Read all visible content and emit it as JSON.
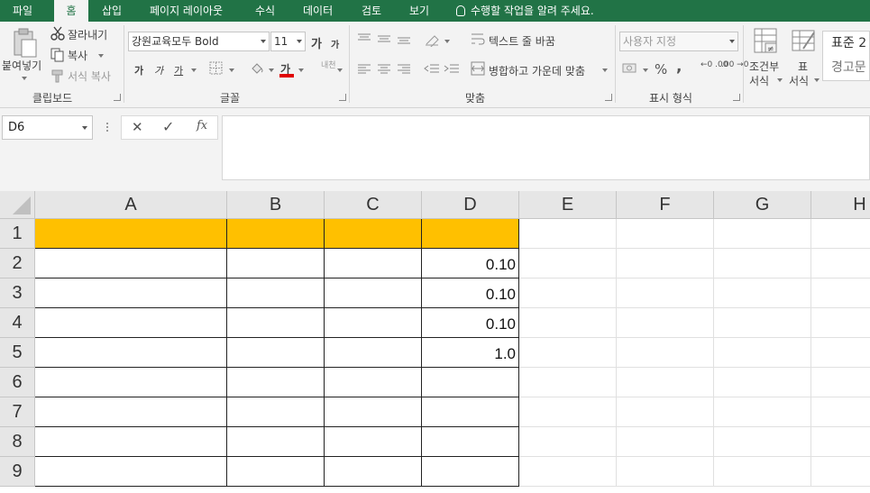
{
  "ribbon_tabs": [
    {
      "label": "파일",
      "active": false
    },
    {
      "label": "홈",
      "active": true
    },
    {
      "label": "삽입",
      "active": false
    },
    {
      "label": "페이지 레이아웃",
      "active": false
    },
    {
      "label": "수식",
      "active": false
    },
    {
      "label": "데이터",
      "active": false
    },
    {
      "label": "검토",
      "active": false
    },
    {
      "label": "보기",
      "active": false
    }
  ],
  "tell_me": "수행할 작업을 알려 주세요.",
  "clipboard": {
    "paste_label": "붙여넣기",
    "cut_label": "잘라내기",
    "copy_label": "복사",
    "format_painter_label": "서식 복사",
    "group_label": "클립보드"
  },
  "font": {
    "font_name": "강원교육모두 Bold",
    "font_size": "11",
    "bold_glyph": "가",
    "italic_glyph": "가",
    "underline_glyph": "가",
    "font_color_glyph": "가",
    "grow_glyph": "가",
    "shrink_glyph": "가",
    "phonetic_glyph": "내천",
    "group_label": "글꼴"
  },
  "alignment": {
    "wrap_text_label": "텍스트 줄 바꿈",
    "merge_label": "병합하고 가운데 맞춤",
    "group_label": "맞춤"
  },
  "number": {
    "format_value": "사용자 지정",
    "percent_glyph": "%",
    "comma_glyph": ",",
    "inc_decimal_glyph": "←0 .00",
    "dec_decimal_glyph": ".00 →0",
    "group_label": "표시 형식"
  },
  "styles": {
    "conditional_label": "조건부",
    "conditional_sub": "서식",
    "table_label": "표",
    "table_sub": "서식",
    "style_normal": "표준 2",
    "style_warning": "경고문"
  },
  "formula_bar": {
    "name_box": "D6",
    "cancel_glyph": "✕",
    "enter_glyph": "✓",
    "fx_glyph": "fx",
    "formula": ""
  },
  "sheet": {
    "columns": [
      "A",
      "B",
      "C",
      "D",
      "E",
      "F",
      "G",
      "H"
    ],
    "rows": [
      "1",
      "2",
      "3",
      "4",
      "5",
      "6",
      "7",
      "8",
      "9"
    ],
    "header_fill_color": "#FFC000",
    "d_values": [
      "",
      "0.10",
      "0.10",
      "0.10",
      "1.0",
      "",
      "",
      "",
      ""
    ]
  }
}
